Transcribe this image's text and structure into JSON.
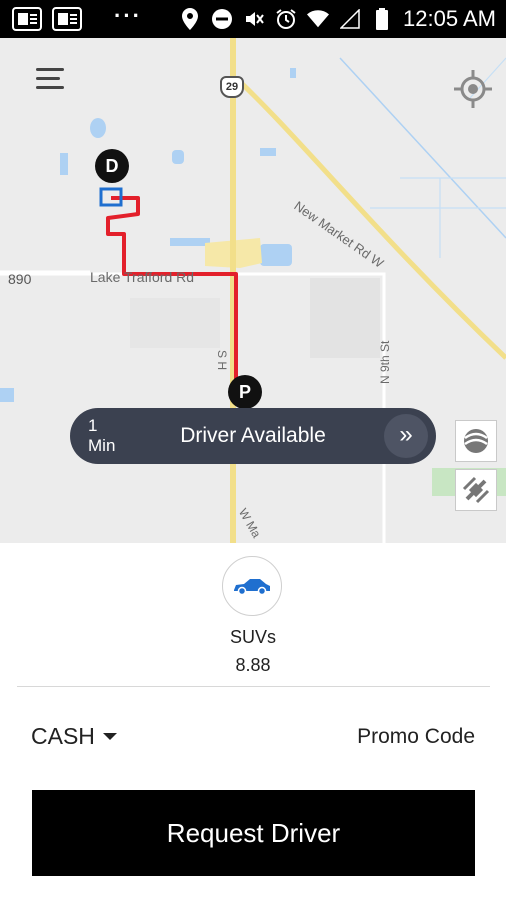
{
  "status_bar": {
    "time": "12:05 AM",
    "icons": [
      "news-app-icon",
      "news-app-icon",
      "more-dots-icon",
      "location-icon",
      "do-not-disturb-icon",
      "mute-icon",
      "alarm-icon",
      "wifi-icon",
      "cell-signal-icon",
      "battery-icon"
    ],
    "more": "···"
  },
  "map": {
    "highway_shield": "29",
    "roads": {
      "left_label": "890",
      "lake_trafford": "Lake Trafford Rd",
      "new_market": "New Market Rd W",
      "n_9th": "N 9th St",
      "sh": "S H",
      "w_ma": "W Ma"
    },
    "pins": {
      "dropoff": "D",
      "pickup": "P"
    },
    "route_color": "#e3202b"
  },
  "banner": {
    "eta_value": "1",
    "eta_unit": "Min",
    "text": "Driver Available",
    "arrow": "»"
  },
  "vehicle": {
    "name": "SUVs",
    "price": "8.88",
    "icon": "car-icon",
    "icon_color": "#1f6fcf"
  },
  "payment": {
    "method": "CASH",
    "promo": "Promo Code"
  },
  "request_button": "Request Driver"
}
